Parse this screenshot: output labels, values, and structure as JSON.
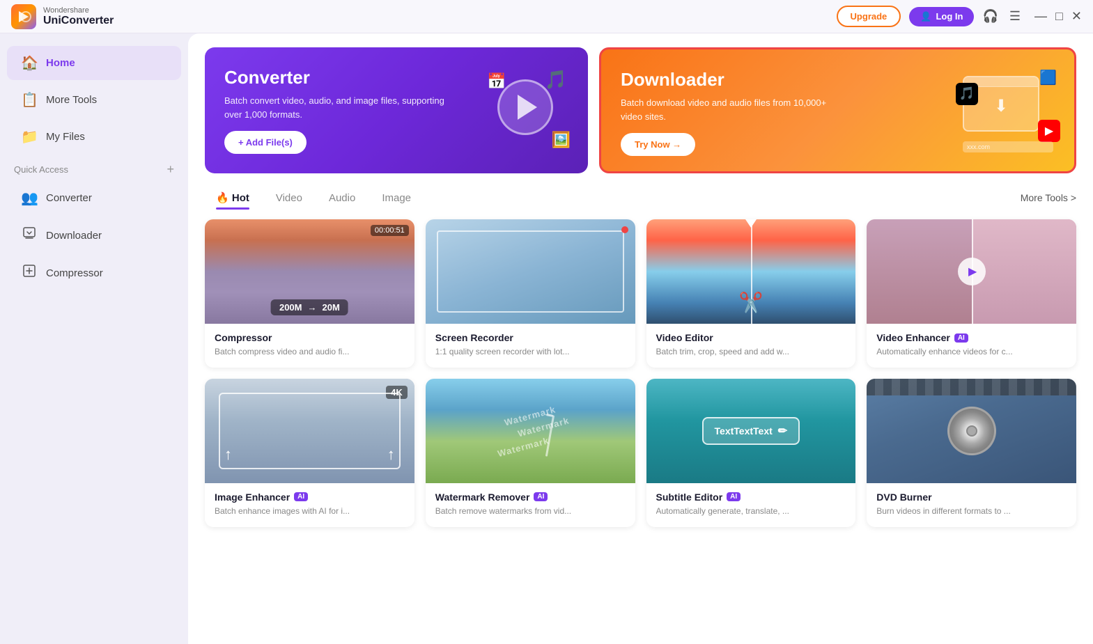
{
  "app": {
    "name_top": "Wondershare",
    "name_bottom": "UniConverter",
    "logo_icon": "▶"
  },
  "titlebar": {
    "upgrade_label": "Upgrade",
    "login_label": "Log In",
    "headphone_icon": "🎧",
    "menu_icon": "☰",
    "minimize_icon": "—",
    "maximize_icon": "□",
    "close_icon": "✕"
  },
  "sidebar": {
    "items": [
      {
        "label": "Home",
        "icon": "🏠",
        "active": true
      },
      {
        "label": "More Tools",
        "icon": "📋",
        "active": false
      },
      {
        "label": "My Files",
        "icon": "📁",
        "active": false
      }
    ],
    "quick_access_label": "Quick Access",
    "quick_access_add": "+",
    "quick_items": [
      {
        "label": "Converter",
        "icon": "🔄"
      },
      {
        "label": "Downloader",
        "icon": "⬇️"
      },
      {
        "label": "Compressor",
        "icon": "🗜"
      }
    ]
  },
  "hero": {
    "converter": {
      "title": "Converter",
      "description": "Batch convert video, audio, and image files, supporting over 1,000 formats.",
      "button_label": "+ Add File(s)"
    },
    "downloader": {
      "title": "Downloader",
      "description": "Batch download video and audio files from 10,000+ video sites.",
      "button_label": "Try Now →"
    }
  },
  "tabs": {
    "items": [
      {
        "label": "Hot",
        "active": true,
        "hot_icon": "🔥"
      },
      {
        "label": "Video",
        "active": false
      },
      {
        "label": "Audio",
        "active": false
      },
      {
        "label": "Image",
        "active": false
      }
    ],
    "more_tools_label": "More Tools >"
  },
  "tools": [
    {
      "title": "Compressor",
      "description": "Batch compress video and audio fi...",
      "ai": false,
      "timestamp": "00:00:51",
      "compress_from": "200M",
      "compress_to": "20M"
    },
    {
      "title": "Screen Recorder",
      "description": "1:1 quality screen recorder with lot...",
      "ai": false
    },
    {
      "title": "Video Editor",
      "description": "Batch trim, crop, speed and add w...",
      "ai": false
    },
    {
      "title": "Video Enhancer",
      "description": "Automatically enhance videos for c...",
      "ai": true
    },
    {
      "title": "Image Enhancer",
      "description": "Batch enhance images with AI for i...",
      "ai": true,
      "k_label": "4K"
    },
    {
      "title": "Watermark Remover",
      "description": "Batch remove watermarks from vid...",
      "ai": true
    },
    {
      "title": "Subtitle Editor",
      "description": "Automatically generate, translate, ...",
      "ai": true,
      "subtitle_text": "TextTextText"
    },
    {
      "title": "DVD Burner",
      "description": "Burn videos in different formats to ...",
      "ai": false
    }
  ],
  "labels": {
    "arrow_right": "→",
    "compress_arrow": "→",
    "ai_badge": "AI",
    "edit_icon": "✏"
  }
}
